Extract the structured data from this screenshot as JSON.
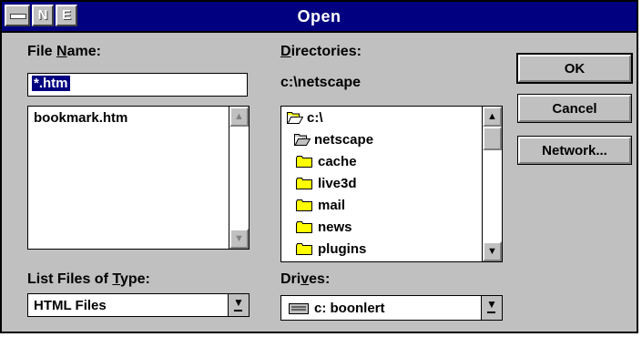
{
  "window": {
    "title": "Open"
  },
  "file_name": {
    "label_pre": "File ",
    "label_key": "N",
    "label_post": "ame:",
    "value": "*.htm",
    "files": [
      "bookmark.htm"
    ]
  },
  "directories": {
    "label_key": "D",
    "label_post": "irectories:",
    "current_path": "c:\\netscape",
    "items": [
      {
        "name": "c:\\",
        "icon": "open-folder-icon"
      },
      {
        "name": "netscape",
        "icon": "open-folder-icon"
      },
      {
        "name": "cache",
        "icon": "folder-icon"
      },
      {
        "name": "live3d",
        "icon": "folder-icon"
      },
      {
        "name": "mail",
        "icon": "folder-icon"
      },
      {
        "name": "news",
        "icon": "folder-icon"
      },
      {
        "name": "plugins",
        "icon": "folder-icon"
      }
    ]
  },
  "file_type": {
    "label_pre": "List Files of ",
    "label_key": "T",
    "label_post": "ype:",
    "value": "HTML Files"
  },
  "drives": {
    "label_pre": "Dri",
    "label_key": "v",
    "label_post": "es:",
    "value": "c: boonlert"
  },
  "buttons": {
    "ok": "OK",
    "cancel": "Cancel",
    "network": "Network..."
  },
  "colors": {
    "titlebar": "#000080",
    "face": "#c0c0c0",
    "selection": "#000080"
  }
}
